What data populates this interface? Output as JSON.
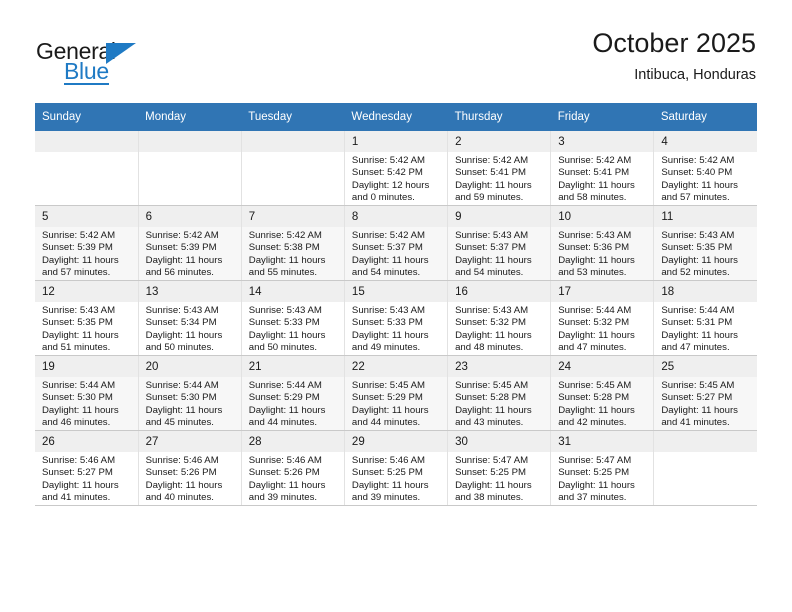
{
  "logo": {
    "word_top": "General",
    "word_bottom": "Blue",
    "triangle_icon": "triangle-icon"
  },
  "header": {
    "title": "October 2025",
    "location": "Intibuca, Honduras"
  },
  "calendar": {
    "weekday_headers": [
      "Sunday",
      "Monday",
      "Tuesday",
      "Wednesday",
      "Thursday",
      "Friday",
      "Saturday"
    ],
    "labels": {
      "sunrise": "Sunrise:",
      "sunset": "Sunset:",
      "daylight": "Daylight:"
    },
    "weeks": [
      [
        {
          "day": "",
          "empty": true
        },
        {
          "day": "",
          "empty": true
        },
        {
          "day": "",
          "empty": true
        },
        {
          "day": "1",
          "sunrise": "Sunrise: 5:42 AM",
          "sunset": "Sunset: 5:42 PM",
          "daylight_l1": "Daylight: 12 hours",
          "daylight_l2": "and 0 minutes."
        },
        {
          "day": "2",
          "sunrise": "Sunrise: 5:42 AM",
          "sunset": "Sunset: 5:41 PM",
          "daylight_l1": "Daylight: 11 hours",
          "daylight_l2": "and 59 minutes."
        },
        {
          "day": "3",
          "sunrise": "Sunrise: 5:42 AM",
          "sunset": "Sunset: 5:41 PM",
          "daylight_l1": "Daylight: 11 hours",
          "daylight_l2": "and 58 minutes."
        },
        {
          "day": "4",
          "sunrise": "Sunrise: 5:42 AM",
          "sunset": "Sunset: 5:40 PM",
          "daylight_l1": "Daylight: 11 hours",
          "daylight_l2": "and 57 minutes."
        }
      ],
      [
        {
          "day": "5",
          "sunrise": "Sunrise: 5:42 AM",
          "sunset": "Sunset: 5:39 PM",
          "daylight_l1": "Daylight: 11 hours",
          "daylight_l2": "and 57 minutes."
        },
        {
          "day": "6",
          "sunrise": "Sunrise: 5:42 AM",
          "sunset": "Sunset: 5:39 PM",
          "daylight_l1": "Daylight: 11 hours",
          "daylight_l2": "and 56 minutes."
        },
        {
          "day": "7",
          "sunrise": "Sunrise: 5:42 AM",
          "sunset": "Sunset: 5:38 PM",
          "daylight_l1": "Daylight: 11 hours",
          "daylight_l2": "and 55 minutes."
        },
        {
          "day": "8",
          "sunrise": "Sunrise: 5:42 AM",
          "sunset": "Sunset: 5:37 PM",
          "daylight_l1": "Daylight: 11 hours",
          "daylight_l2": "and 54 minutes."
        },
        {
          "day": "9",
          "sunrise": "Sunrise: 5:43 AM",
          "sunset": "Sunset: 5:37 PM",
          "daylight_l1": "Daylight: 11 hours",
          "daylight_l2": "and 54 minutes."
        },
        {
          "day": "10",
          "sunrise": "Sunrise: 5:43 AM",
          "sunset": "Sunset: 5:36 PM",
          "daylight_l1": "Daylight: 11 hours",
          "daylight_l2": "and 53 minutes."
        },
        {
          "day": "11",
          "sunrise": "Sunrise: 5:43 AM",
          "sunset": "Sunset: 5:35 PM",
          "daylight_l1": "Daylight: 11 hours",
          "daylight_l2": "and 52 minutes."
        }
      ],
      [
        {
          "day": "12",
          "sunrise": "Sunrise: 5:43 AM",
          "sunset": "Sunset: 5:35 PM",
          "daylight_l1": "Daylight: 11 hours",
          "daylight_l2": "and 51 minutes."
        },
        {
          "day": "13",
          "sunrise": "Sunrise: 5:43 AM",
          "sunset": "Sunset: 5:34 PM",
          "daylight_l1": "Daylight: 11 hours",
          "daylight_l2": "and 50 minutes."
        },
        {
          "day": "14",
          "sunrise": "Sunrise: 5:43 AM",
          "sunset": "Sunset: 5:33 PM",
          "daylight_l1": "Daylight: 11 hours",
          "daylight_l2": "and 50 minutes."
        },
        {
          "day": "15",
          "sunrise": "Sunrise: 5:43 AM",
          "sunset": "Sunset: 5:33 PM",
          "daylight_l1": "Daylight: 11 hours",
          "daylight_l2": "and 49 minutes."
        },
        {
          "day": "16",
          "sunrise": "Sunrise: 5:43 AM",
          "sunset": "Sunset: 5:32 PM",
          "daylight_l1": "Daylight: 11 hours",
          "daylight_l2": "and 48 minutes."
        },
        {
          "day": "17",
          "sunrise": "Sunrise: 5:44 AM",
          "sunset": "Sunset: 5:32 PM",
          "daylight_l1": "Daylight: 11 hours",
          "daylight_l2": "and 47 minutes."
        },
        {
          "day": "18",
          "sunrise": "Sunrise: 5:44 AM",
          "sunset": "Sunset: 5:31 PM",
          "daylight_l1": "Daylight: 11 hours",
          "daylight_l2": "and 47 minutes."
        }
      ],
      [
        {
          "day": "19",
          "sunrise": "Sunrise: 5:44 AM",
          "sunset": "Sunset: 5:30 PM",
          "daylight_l1": "Daylight: 11 hours",
          "daylight_l2": "and 46 minutes."
        },
        {
          "day": "20",
          "sunrise": "Sunrise: 5:44 AM",
          "sunset": "Sunset: 5:30 PM",
          "daylight_l1": "Daylight: 11 hours",
          "daylight_l2": "and 45 minutes."
        },
        {
          "day": "21",
          "sunrise": "Sunrise: 5:44 AM",
          "sunset": "Sunset: 5:29 PM",
          "daylight_l1": "Daylight: 11 hours",
          "daylight_l2": "and 44 minutes."
        },
        {
          "day": "22",
          "sunrise": "Sunrise: 5:45 AM",
          "sunset": "Sunset: 5:29 PM",
          "daylight_l1": "Daylight: 11 hours",
          "daylight_l2": "and 44 minutes."
        },
        {
          "day": "23",
          "sunrise": "Sunrise: 5:45 AM",
          "sunset": "Sunset: 5:28 PM",
          "daylight_l1": "Daylight: 11 hours",
          "daylight_l2": "and 43 minutes."
        },
        {
          "day": "24",
          "sunrise": "Sunrise: 5:45 AM",
          "sunset": "Sunset: 5:28 PM",
          "daylight_l1": "Daylight: 11 hours",
          "daylight_l2": "and 42 minutes."
        },
        {
          "day": "25",
          "sunrise": "Sunrise: 5:45 AM",
          "sunset": "Sunset: 5:27 PM",
          "daylight_l1": "Daylight: 11 hours",
          "daylight_l2": "and 41 minutes."
        }
      ],
      [
        {
          "day": "26",
          "sunrise": "Sunrise: 5:46 AM",
          "sunset": "Sunset: 5:27 PM",
          "daylight_l1": "Daylight: 11 hours",
          "daylight_l2": "and 41 minutes."
        },
        {
          "day": "27",
          "sunrise": "Sunrise: 5:46 AM",
          "sunset": "Sunset: 5:26 PM",
          "daylight_l1": "Daylight: 11 hours",
          "daylight_l2": "and 40 minutes."
        },
        {
          "day": "28",
          "sunrise": "Sunrise: 5:46 AM",
          "sunset": "Sunset: 5:26 PM",
          "daylight_l1": "Daylight: 11 hours",
          "daylight_l2": "and 39 minutes."
        },
        {
          "day": "29",
          "sunrise": "Sunrise: 5:46 AM",
          "sunset": "Sunset: 5:25 PM",
          "daylight_l1": "Daylight: 11 hours",
          "daylight_l2": "and 39 minutes."
        },
        {
          "day": "30",
          "sunrise": "Sunrise: 5:47 AM",
          "sunset": "Sunset: 5:25 PM",
          "daylight_l1": "Daylight: 11 hours",
          "daylight_l2": "and 38 minutes."
        },
        {
          "day": "31",
          "sunrise": "Sunrise: 5:47 AM",
          "sunset": "Sunset: 5:25 PM",
          "daylight_l1": "Daylight: 11 hours",
          "daylight_l2": "and 37 minutes."
        },
        {
          "day": "",
          "empty": true
        }
      ]
    ]
  },
  "colors": {
    "header_blue": "#3075b4",
    "logo_blue": "#1f7ac4",
    "row_shade": "#f7f7f7",
    "daynum_band": "#efefef"
  }
}
